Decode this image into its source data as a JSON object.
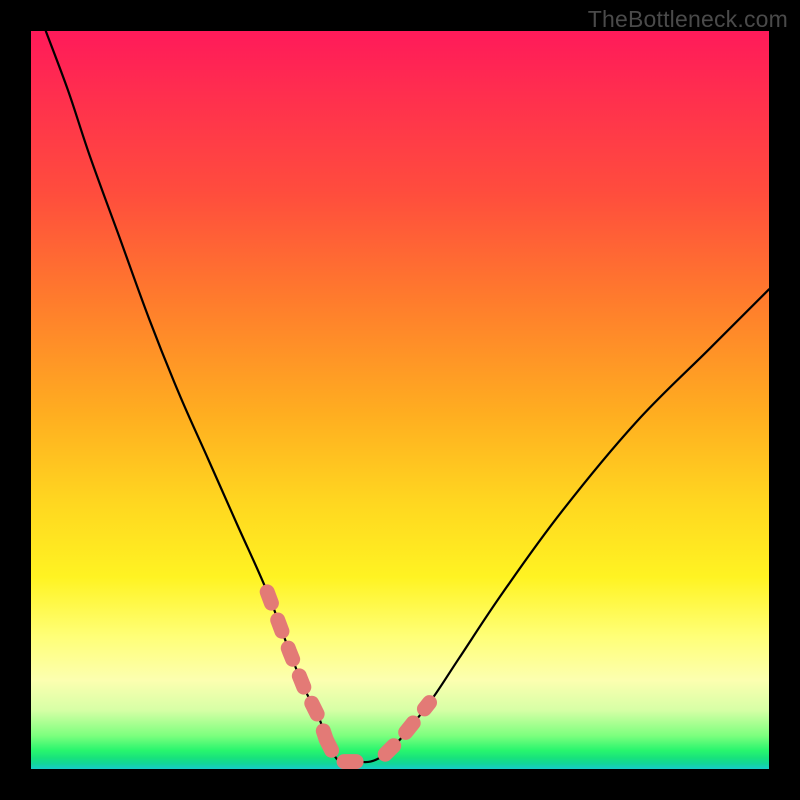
{
  "watermark": "TheBottleneck.com",
  "colors": {
    "background": "#000000",
    "curve_stroke": "#000000",
    "marker_stroke": "#e37a76",
    "gradient_stops": [
      "#ff1a5a",
      "#ff4d3d",
      "#ffae20",
      "#fff322",
      "#fcffb0",
      "#28f56e",
      "#17ccc9"
    ]
  },
  "chart_data": {
    "type": "line",
    "title": "",
    "xlabel": "",
    "ylabel": "",
    "xlim": [
      0,
      100
    ],
    "ylim": [
      0,
      100
    ],
    "grid": false,
    "series": [
      {
        "name": "bottleneck-curve",
        "x": [
          2,
          5,
          8,
          12,
          16,
          20,
          24,
          28,
          32,
          35,
          37,
          39,
          40,
          41,
          42,
          44,
          46,
          48,
          50,
          54,
          58,
          64,
          72,
          82,
          92,
          100
        ],
        "values": [
          100,
          92,
          83,
          72,
          61,
          51,
          42,
          33,
          24,
          16,
          11,
          7,
          4,
          2,
          1,
          1,
          1,
          2,
          4,
          9,
          15,
          24,
          35,
          47,
          57,
          65
        ]
      }
    ],
    "annotations": [
      {
        "name": "marker-left-slope",
        "type": "thick-dash-segment",
        "points_index_range": [
          8,
          12
        ]
      },
      {
        "name": "marker-valley-floor",
        "type": "thick-dash-segment",
        "points_index_range": [
          12,
          16
        ]
      },
      {
        "name": "marker-right-slope",
        "type": "thick-dash-segment",
        "points_index_range": [
          17,
          19
        ]
      }
    ]
  }
}
